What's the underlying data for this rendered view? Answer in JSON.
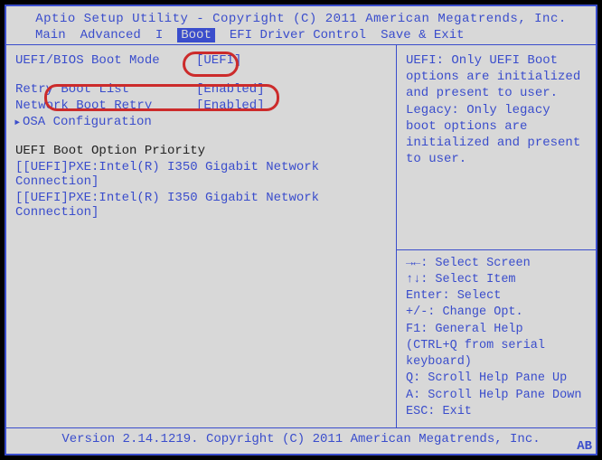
{
  "title": "Aptio Setup Utility - Copyright (C) 2011 American Megatrends, Inc.",
  "footer": "Version 2.14.1219. Copyright (C) 2011 American Megatrends, Inc.",
  "badge": "AB",
  "tabs": {
    "main": "Main",
    "advanced": "Advanced",
    "i_something": "I",
    "boot": "Boot",
    "efi": "EFI Driver Control",
    "saveexit": "Save & Exit"
  },
  "left": {
    "bootmode_label": "UEFI/BIOS Boot Mode",
    "bootmode_value": "[UEFI]",
    "retry_label": "Retry Boot List",
    "retry_value": "[Enabled]",
    "netretry_label": "Network Boot Retry",
    "netretry_value": "[Enabled]",
    "osa_label": "OSA Configuration",
    "priority_header": "UEFI Boot Option Priority",
    "opt1": "[[UEFI]PXE:Intel(R) I350 Gigabit Network Connection]",
    "opt2": "[[UEFI]PXE:Intel(R) I350 Gigabit Network Connection]"
  },
  "help": {
    "text": "UEFI: Only UEFI Boot options are initialized and present to user. Legacy: Only legacy boot options are initialized and present to user.",
    "k1": "→←: Select Screen",
    "k2": "↑↓: Select Item",
    "k3": "Enter: Select",
    "k4": "+/-: Change Opt.",
    "k5": "F1: General Help",
    "k6": " (CTRL+Q from serial keyboard)",
    "k7": "Q: Scroll Help Pane Up",
    "k8": "A: Scroll Help Pane Down",
    "k9": "ESC: Exit"
  }
}
